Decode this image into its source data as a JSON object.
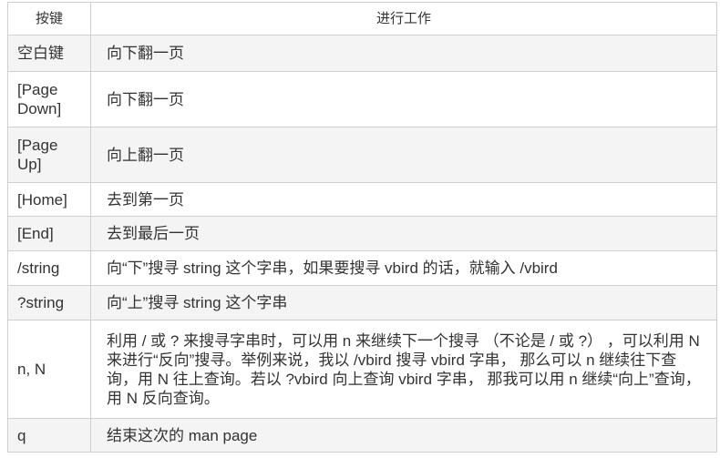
{
  "headers": {
    "key": "按键",
    "action": "进行工作"
  },
  "rows": [
    {
      "key": "空白键",
      "action": "向下翻一页"
    },
    {
      "key": "[Page Down]",
      "action": "向下翻一页"
    },
    {
      "key": "[Page Up]",
      "action": "向上翻一页"
    },
    {
      "key": "[Home]",
      "action": "去到第一页"
    },
    {
      "key": "[End]",
      "action": "去到最后一页"
    },
    {
      "key": "/string",
      "action": "向“下”搜寻 string 这个字串，如果要搜寻 vbird 的话，就输入 /vbird"
    },
    {
      "key": "?string",
      "action": "向“上”搜寻 string 这个字串"
    },
    {
      "key": "n, N",
      "action": "利用 / 或 ? 来搜寻字串时，可以用 n 来继续下一个搜寻 （不论是 / 或 ?） ，可以利用 N 来进行“反向”搜寻。举例来说，我以 /vbird 搜寻 vbird 字串， 那么可以 n 继续往下查询，用 N 往上查询。若以 ?vbird 向上查询 vbird 字串， 那我可以用 n 继续“向上”查询，用 N 反向查询。"
    },
    {
      "key": "q",
      "action": "结束这次的 man page"
    }
  ]
}
